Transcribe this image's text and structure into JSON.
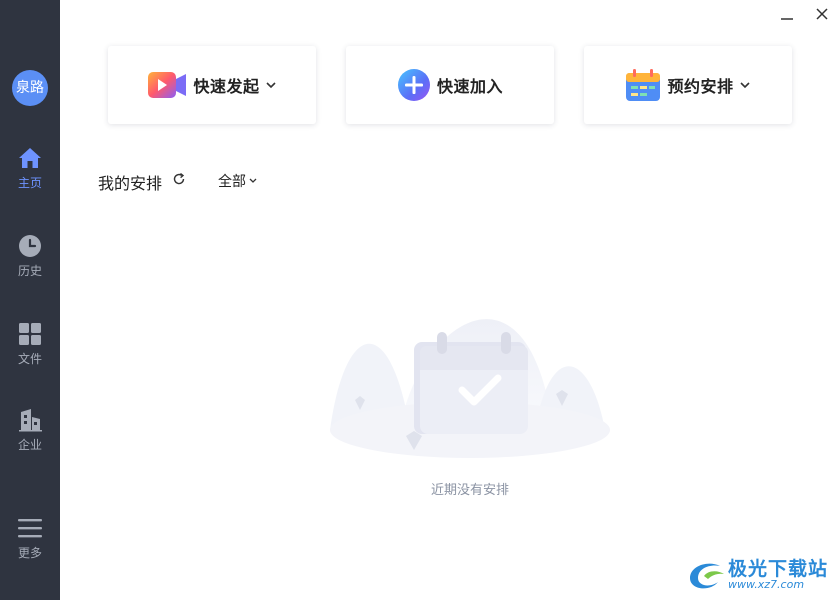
{
  "window": {
    "minimize_icon": "minimize-icon",
    "close_icon": "close-icon"
  },
  "sidebar": {
    "avatar_text": "泉路",
    "items": [
      {
        "label": "主页",
        "icon": "home-icon"
      },
      {
        "label": "历史",
        "icon": "clock-icon"
      },
      {
        "label": "文件",
        "icon": "grid-icon"
      },
      {
        "label": "企业",
        "icon": "building-icon"
      },
      {
        "label": "更多",
        "icon": "menu-icon"
      }
    ],
    "active_color": "#6e93ff"
  },
  "actions": {
    "quick_start": "快速发起",
    "quick_join": "快速加入",
    "schedule": "预约安排"
  },
  "schedule_section": {
    "title": "我的安排",
    "filter": "全部",
    "empty_text": "近期没有安排"
  },
  "watermark": {
    "main": "极光下载站",
    "sub": "www.xz7.com"
  }
}
